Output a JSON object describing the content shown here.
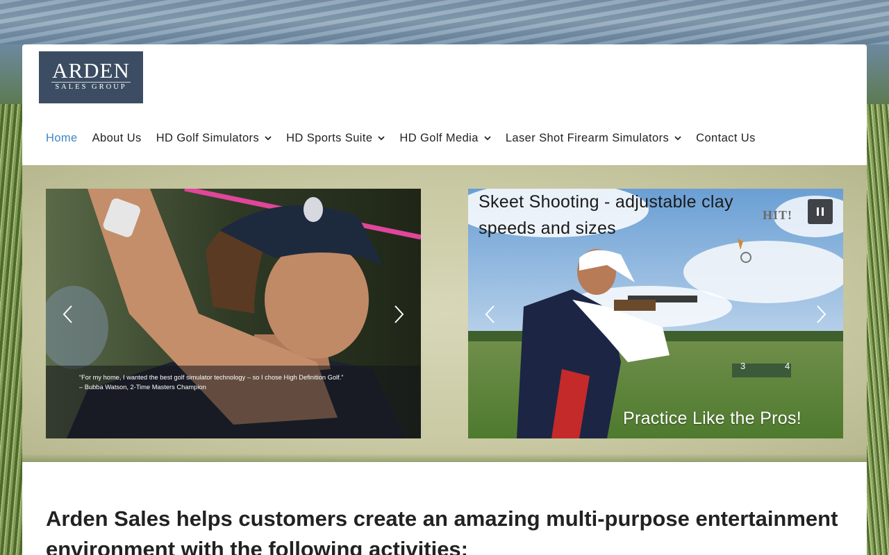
{
  "logo": {
    "word": "ARDEN",
    "sub": "SALES GROUP"
  },
  "nav": {
    "items": [
      {
        "label": "Home",
        "active": true,
        "dropdown": false
      },
      {
        "label": "About Us",
        "active": false,
        "dropdown": false
      },
      {
        "label": "HD Golf Simulators",
        "active": false,
        "dropdown": true
      },
      {
        "label": "HD Sports Suite",
        "active": false,
        "dropdown": true
      },
      {
        "label": "HD Golf Media",
        "active": false,
        "dropdown": true
      },
      {
        "label": "Laser Shot Firearm Simulators",
        "active": false,
        "dropdown": true
      },
      {
        "label": "Contact Us",
        "active": false,
        "dropdown": false
      }
    ],
    "active_color": "#3d86c6"
  },
  "slider_left": {
    "quote_line1": "“For my home, I wanted the best golf simulator technology – so I chose High Definition Golf.”",
    "quote_line2": "– Bubba Watson, 2-Time Masters Champion"
  },
  "slider_right": {
    "title": "Skeet Shooting - adjustable clay speeds and sizes",
    "hit_text": "HIT!",
    "tagline": "Practice Like the Pros!",
    "score_3": "3",
    "score_4": "4"
  },
  "main": {
    "headline": "Arden Sales helps customers create an amazing multi-purpose entertainment environment with the following activities:"
  },
  "icons": {
    "prev": "chevron-left-icon",
    "next": "chevron-right-icon",
    "pause": "pause-icon",
    "dropdown": "chevron-down-icon"
  }
}
